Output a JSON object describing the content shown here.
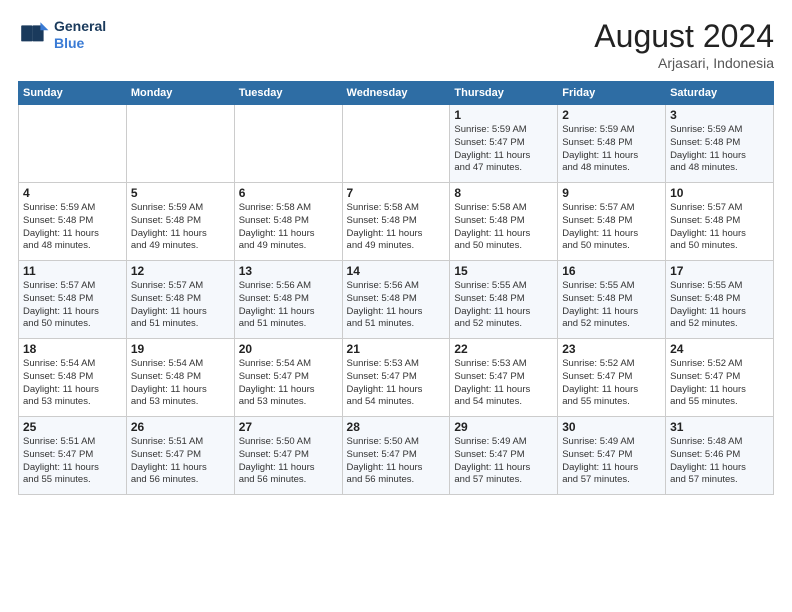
{
  "header": {
    "logo_line1": "General",
    "logo_line2": "Blue",
    "month_title": "August 2024",
    "location": "Arjasari, Indonesia"
  },
  "days_of_week": [
    "Sunday",
    "Monday",
    "Tuesday",
    "Wednesday",
    "Thursday",
    "Friday",
    "Saturday"
  ],
  "weeks": [
    [
      {
        "day": "",
        "info": ""
      },
      {
        "day": "",
        "info": ""
      },
      {
        "day": "",
        "info": ""
      },
      {
        "day": "",
        "info": ""
      },
      {
        "day": "1",
        "info": "Sunrise: 5:59 AM\nSunset: 5:47 PM\nDaylight: 11 hours\nand 47 minutes."
      },
      {
        "day": "2",
        "info": "Sunrise: 5:59 AM\nSunset: 5:48 PM\nDaylight: 11 hours\nand 48 minutes."
      },
      {
        "day": "3",
        "info": "Sunrise: 5:59 AM\nSunset: 5:48 PM\nDaylight: 11 hours\nand 48 minutes."
      }
    ],
    [
      {
        "day": "4",
        "info": "Sunrise: 5:59 AM\nSunset: 5:48 PM\nDaylight: 11 hours\nand 48 minutes."
      },
      {
        "day": "5",
        "info": "Sunrise: 5:59 AM\nSunset: 5:48 PM\nDaylight: 11 hours\nand 49 minutes."
      },
      {
        "day": "6",
        "info": "Sunrise: 5:58 AM\nSunset: 5:48 PM\nDaylight: 11 hours\nand 49 minutes."
      },
      {
        "day": "7",
        "info": "Sunrise: 5:58 AM\nSunset: 5:48 PM\nDaylight: 11 hours\nand 49 minutes."
      },
      {
        "day": "8",
        "info": "Sunrise: 5:58 AM\nSunset: 5:48 PM\nDaylight: 11 hours\nand 50 minutes."
      },
      {
        "day": "9",
        "info": "Sunrise: 5:57 AM\nSunset: 5:48 PM\nDaylight: 11 hours\nand 50 minutes."
      },
      {
        "day": "10",
        "info": "Sunrise: 5:57 AM\nSunset: 5:48 PM\nDaylight: 11 hours\nand 50 minutes."
      }
    ],
    [
      {
        "day": "11",
        "info": "Sunrise: 5:57 AM\nSunset: 5:48 PM\nDaylight: 11 hours\nand 50 minutes."
      },
      {
        "day": "12",
        "info": "Sunrise: 5:57 AM\nSunset: 5:48 PM\nDaylight: 11 hours\nand 51 minutes."
      },
      {
        "day": "13",
        "info": "Sunrise: 5:56 AM\nSunset: 5:48 PM\nDaylight: 11 hours\nand 51 minutes."
      },
      {
        "day": "14",
        "info": "Sunrise: 5:56 AM\nSunset: 5:48 PM\nDaylight: 11 hours\nand 51 minutes."
      },
      {
        "day": "15",
        "info": "Sunrise: 5:55 AM\nSunset: 5:48 PM\nDaylight: 11 hours\nand 52 minutes."
      },
      {
        "day": "16",
        "info": "Sunrise: 5:55 AM\nSunset: 5:48 PM\nDaylight: 11 hours\nand 52 minutes."
      },
      {
        "day": "17",
        "info": "Sunrise: 5:55 AM\nSunset: 5:48 PM\nDaylight: 11 hours\nand 52 minutes."
      }
    ],
    [
      {
        "day": "18",
        "info": "Sunrise: 5:54 AM\nSunset: 5:48 PM\nDaylight: 11 hours\nand 53 minutes."
      },
      {
        "day": "19",
        "info": "Sunrise: 5:54 AM\nSunset: 5:48 PM\nDaylight: 11 hours\nand 53 minutes."
      },
      {
        "day": "20",
        "info": "Sunrise: 5:54 AM\nSunset: 5:47 PM\nDaylight: 11 hours\nand 53 minutes."
      },
      {
        "day": "21",
        "info": "Sunrise: 5:53 AM\nSunset: 5:47 PM\nDaylight: 11 hours\nand 54 minutes."
      },
      {
        "day": "22",
        "info": "Sunrise: 5:53 AM\nSunset: 5:47 PM\nDaylight: 11 hours\nand 54 minutes."
      },
      {
        "day": "23",
        "info": "Sunrise: 5:52 AM\nSunset: 5:47 PM\nDaylight: 11 hours\nand 55 minutes."
      },
      {
        "day": "24",
        "info": "Sunrise: 5:52 AM\nSunset: 5:47 PM\nDaylight: 11 hours\nand 55 minutes."
      }
    ],
    [
      {
        "day": "25",
        "info": "Sunrise: 5:51 AM\nSunset: 5:47 PM\nDaylight: 11 hours\nand 55 minutes."
      },
      {
        "day": "26",
        "info": "Sunrise: 5:51 AM\nSunset: 5:47 PM\nDaylight: 11 hours\nand 56 minutes."
      },
      {
        "day": "27",
        "info": "Sunrise: 5:50 AM\nSunset: 5:47 PM\nDaylight: 11 hours\nand 56 minutes."
      },
      {
        "day": "28",
        "info": "Sunrise: 5:50 AM\nSunset: 5:47 PM\nDaylight: 11 hours\nand 56 minutes."
      },
      {
        "day": "29",
        "info": "Sunrise: 5:49 AM\nSunset: 5:47 PM\nDaylight: 11 hours\nand 57 minutes."
      },
      {
        "day": "30",
        "info": "Sunrise: 5:49 AM\nSunset: 5:47 PM\nDaylight: 11 hours\nand 57 minutes."
      },
      {
        "day": "31",
        "info": "Sunrise: 5:48 AM\nSunset: 5:46 PM\nDaylight: 11 hours\nand 57 minutes."
      }
    ]
  ]
}
